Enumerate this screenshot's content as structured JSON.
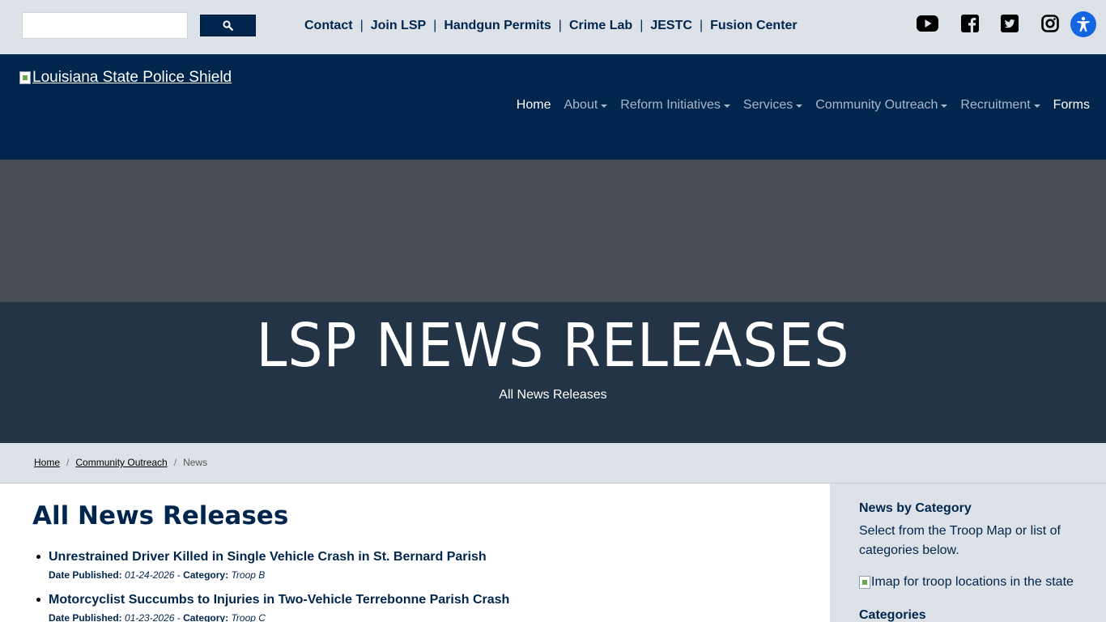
{
  "topbar": {
    "search": {
      "value": "",
      "placeholder": ""
    },
    "links": [
      "Contact",
      "Join LSP",
      "Handgun Permits",
      "Crime Lab",
      "JESTC",
      "Fusion Center"
    ],
    "social_icons": [
      "youtube-icon",
      "facebook-icon",
      "twitter-icon",
      "instagram-icon"
    ],
    "accessibility_icon": "accessibility-icon"
  },
  "header": {
    "logo_alt": "Louisiana State Police Shield",
    "nav": [
      {
        "label": "Home",
        "dropdown": false,
        "active": true
      },
      {
        "label": "About",
        "dropdown": true,
        "active": false
      },
      {
        "label": "Reform Initiatives",
        "dropdown": true,
        "active": false
      },
      {
        "label": "Services",
        "dropdown": true,
        "active": false
      },
      {
        "label": "Community Outreach",
        "dropdown": true,
        "active": false
      },
      {
        "label": "Recruitment",
        "dropdown": true,
        "active": false
      },
      {
        "label": "Forms",
        "dropdown": false,
        "active": true
      }
    ]
  },
  "hero": {
    "title": "LSP NEWS RELEASES",
    "subtitle": "All News Releases"
  },
  "breadcrumb": {
    "items": [
      "Home",
      "Community Outreach",
      "News"
    ]
  },
  "main": {
    "heading": "All News Releases",
    "news": [
      {
        "title": "Unrestrained Driver Killed in Single Vehicle Crash in St. Bernard Parish",
        "date_label": "Date Published:",
        "date": "01-24-2026",
        "category_label": "Category:",
        "category": "Troop B"
      },
      {
        "title": "Motorcyclist Succumbs to Injuries in Two-Vehicle Terrebonne Parish Crash",
        "date_label": "Date Published:",
        "date": "01-23-2026",
        "category_label": "Category:",
        "category": "Troop C"
      }
    ]
  },
  "sidebar": {
    "heading": "News by Category",
    "text": "Select from the Troop Map or list of categories below.",
    "map_alt": "Imap for troop locations in the state",
    "categories_heading": "Categories"
  },
  "colors": {
    "navy": "#00264d",
    "topbar_bg": "#dde1e8",
    "hero_gray": "#474c55",
    "hero_band": "#233447",
    "accessibility_blue": "#1565e0"
  }
}
